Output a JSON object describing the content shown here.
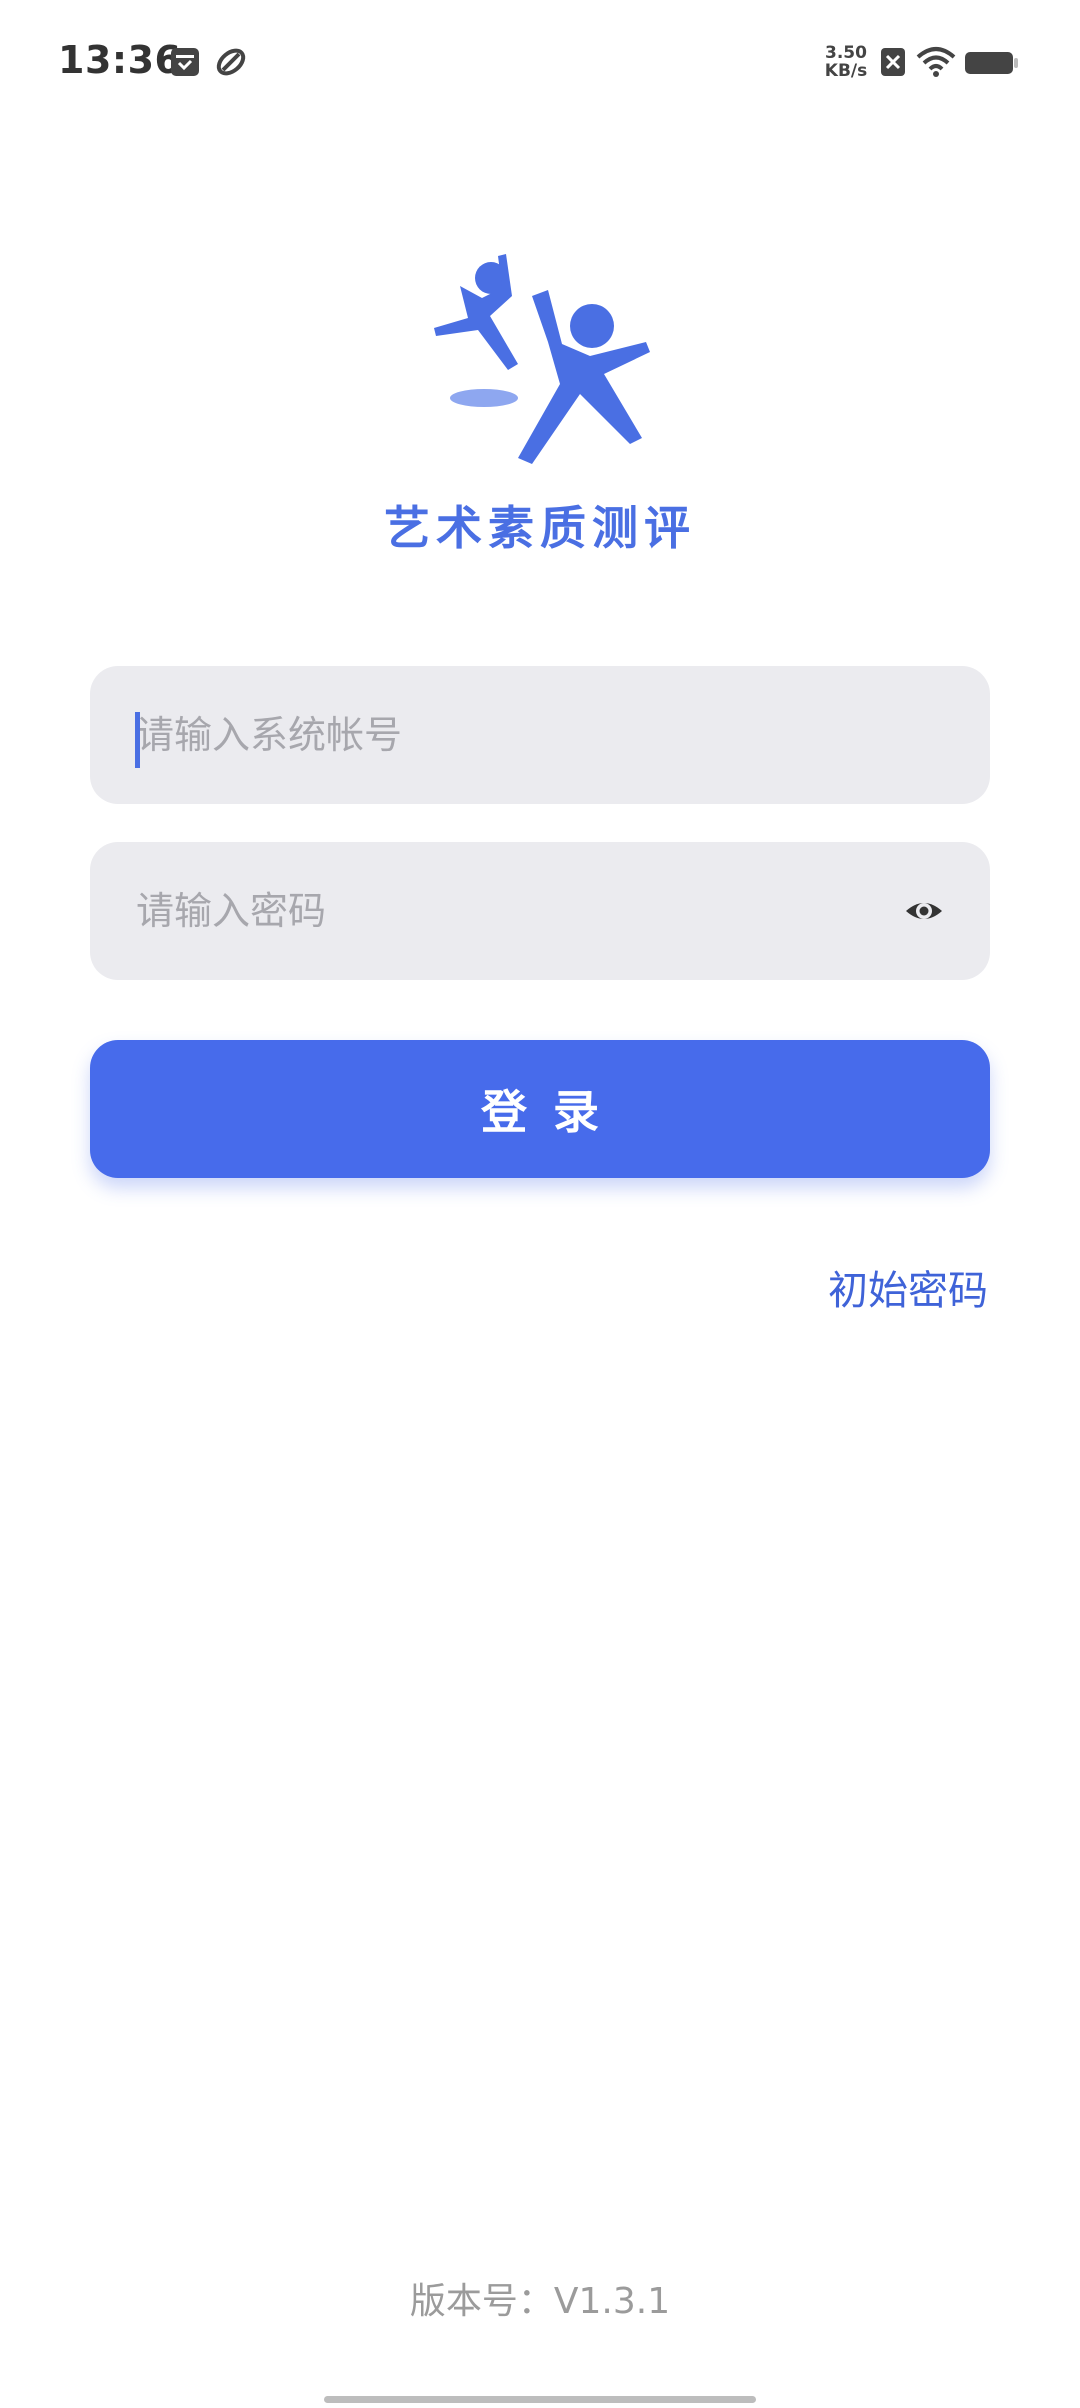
{
  "status_bar": {
    "time": "13:36",
    "net_speed_value": "3.50",
    "net_speed_unit": "KB/s",
    "icons": [
      "calendar-icon",
      "link-icon",
      "sim-off-icon",
      "wifi-icon",
      "battery-icon"
    ]
  },
  "app": {
    "title": "艺术素质测评",
    "logo_color": "#4a6fe3"
  },
  "login_form": {
    "account_placeholder": "请输入系统帐号",
    "account_value": "",
    "password_placeholder": "请输入密码",
    "password_value": "",
    "submit_label": "登录",
    "initial_password_link": "初始密码"
  },
  "footer": {
    "version": "版本号：V1.3.1"
  },
  "colors": {
    "accent": "#476beb",
    "input_bg": "#ebebef",
    "placeholder": "#a7a7ad"
  }
}
